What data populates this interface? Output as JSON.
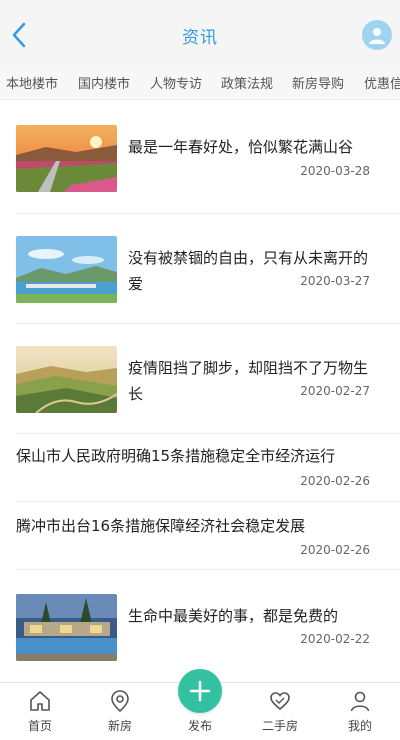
{
  "header": {
    "title": "资讯"
  },
  "tabs": [
    "本地楼市",
    "国内楼市",
    "人物专访",
    "政策法规",
    "新房导购",
    "优惠信"
  ],
  "news": [
    {
      "title": "最是一年春好处，恰似繁花满山谷",
      "date": "2020-03-28",
      "has_image": true
    },
    {
      "title": "没有被禁锢的自由，只有从未离开的爱",
      "date": "2020-03-27",
      "has_image": true
    },
    {
      "title": "疫情阻挡了脚步，却阻挡不了万物生长",
      "date": "2020-02-27",
      "has_image": true
    },
    {
      "title": "保山市人民政府明确15条措施稳定全市经济运行",
      "date": "2020-02-26",
      "has_image": false
    },
    {
      "title": "腾冲市出台16条措施保障经济社会稳定发展",
      "date": "2020-02-26",
      "has_image": false
    },
    {
      "title": "生命中最美好的事，都是免费的",
      "date": "2020-02-22",
      "has_image": true
    }
  ],
  "bottom_nav": [
    {
      "label": "首页",
      "icon": "home-icon"
    },
    {
      "label": "新房",
      "icon": "location-pin-icon"
    },
    {
      "label": "发布",
      "icon": "plus-icon"
    },
    {
      "label": "二手房",
      "icon": "handshake-icon"
    },
    {
      "label": "我的",
      "icon": "user-icon"
    }
  ],
  "colors": {
    "accent": "#2f9be0",
    "publish": "#33c1a1"
  }
}
